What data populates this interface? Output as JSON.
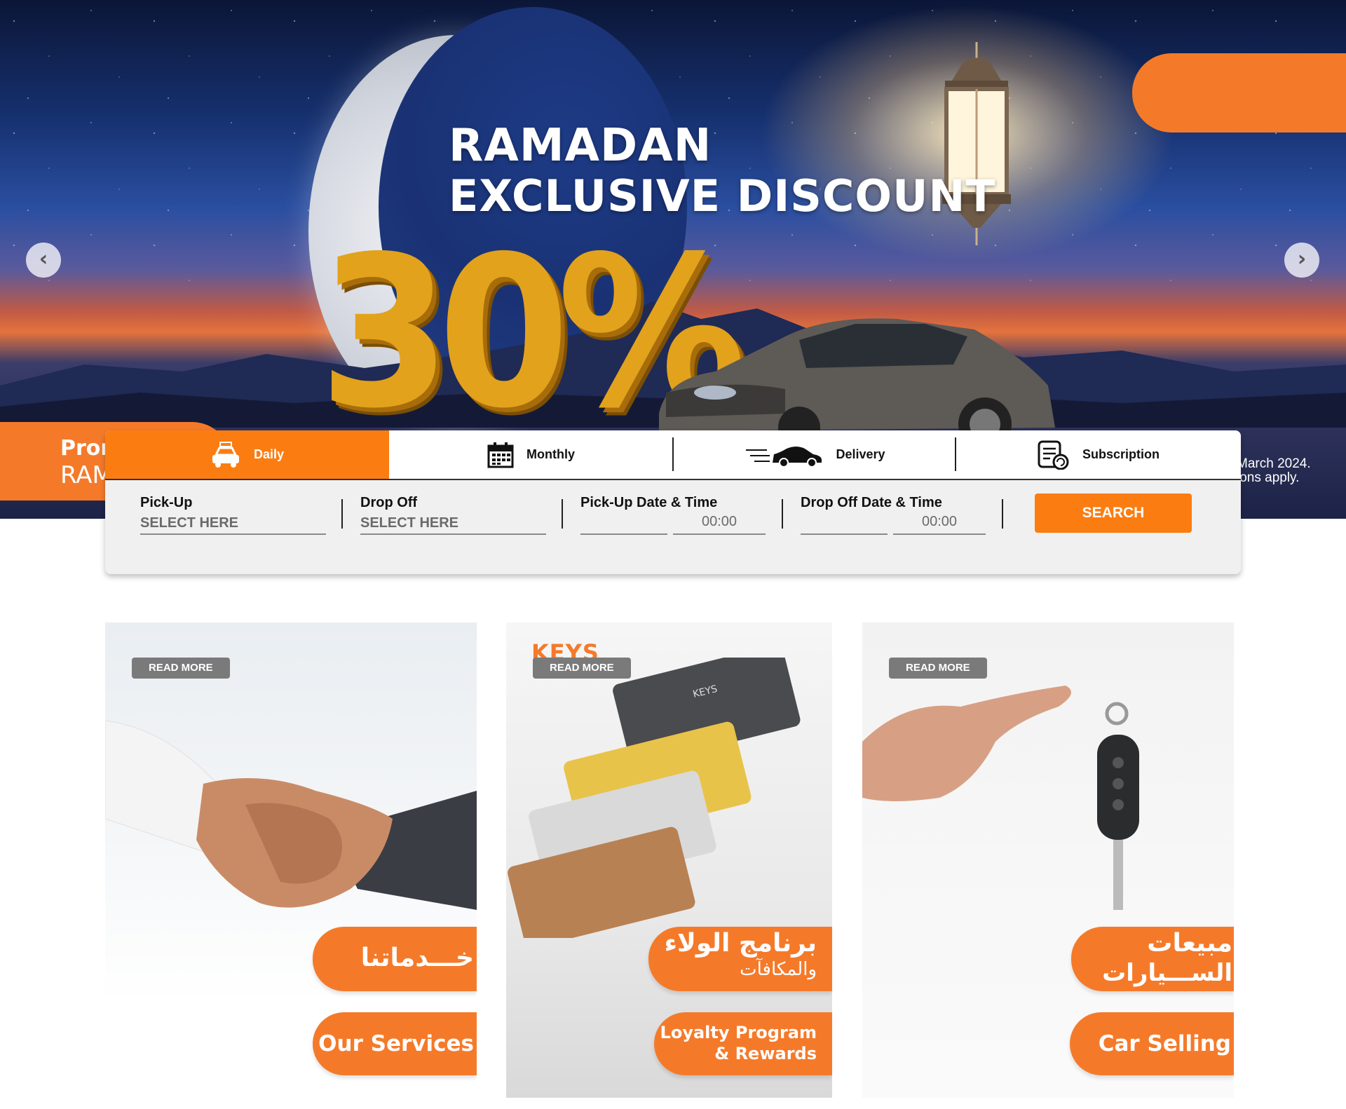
{
  "hero": {
    "title_line1": "RAMADAN",
    "title_line2": "EXCLUSIVE DISCOUNT",
    "discount": "30%",
    "promo_line1": "Pron",
    "promo_line2": "RAM",
    "terms_line1": "March 2024.",
    "terms_line2": "ions apply.",
    "prev_arrow": "‹",
    "next_arrow": "›"
  },
  "booking": {
    "tabs": [
      {
        "label": "Daily",
        "icon": "taxi-car-icon",
        "active": true
      },
      {
        "label": "Monthly",
        "icon": "calendar-icon",
        "active": false
      },
      {
        "label": "Delivery",
        "icon": "fast-car-icon",
        "active": false
      },
      {
        "label": "Subscription",
        "icon": "subscription-icon",
        "active": false
      }
    ],
    "pickup": {
      "label": "Pick-Up",
      "value": "SELECT HERE"
    },
    "dropoff": {
      "label": "Drop Off",
      "value": "SELECT HERE"
    },
    "pickup_datetime": {
      "label": "Pick-Up Date & Time",
      "date": "",
      "time": "00:00"
    },
    "dropoff_datetime": {
      "label": "Drop Off Date & Time",
      "date": "",
      "time": "00:00"
    },
    "search_label": "SEARCH"
  },
  "cards": [
    {
      "read_more": "READ MORE",
      "arabic": "خـــدماتنا",
      "english": "Our Services",
      "image": "handshake"
    },
    {
      "read_more": "READ MORE",
      "arabic": "برنامج الولاء",
      "arabic_sub": "والمكافآت",
      "english": "Loyalty Program",
      "english_sub": "& Rewards",
      "logo": "KEYS",
      "image": "loyalty-cards"
    },
    {
      "read_more": "READ MORE",
      "arabic": "مبيعات",
      "arabic_sub": "الســـيارات",
      "english": "Car Selling",
      "image": "car-key"
    }
  ],
  "colors": {
    "accent": "#fb7d12",
    "pill": "#f47a2a",
    "read_more_bg": "#7a7a7a"
  }
}
